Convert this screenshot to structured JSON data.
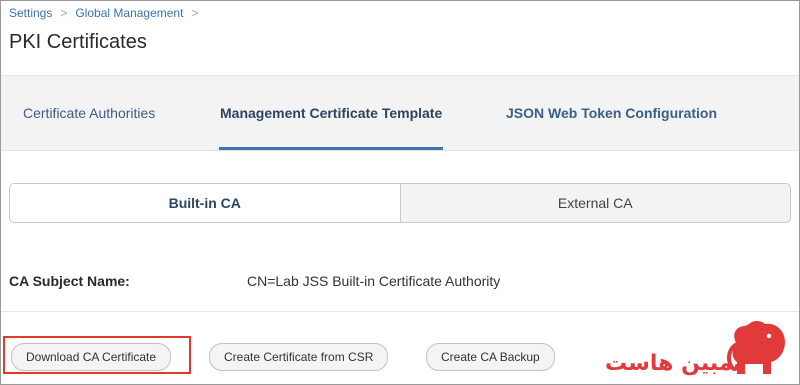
{
  "breadcrumb": {
    "items": [
      "Settings",
      "Global Management"
    ],
    "separator": ">"
  },
  "page": {
    "title": "PKI Certificates"
  },
  "tabs": [
    {
      "label": "Certificate Authorities",
      "active": false
    },
    {
      "label": "Management Certificate Template",
      "active": true
    },
    {
      "label": "JSON Web Token Configuration",
      "active": false
    }
  ],
  "ca_toggle": {
    "options": [
      "Built-in CA",
      "External CA"
    ],
    "selected": "Built-in CA"
  },
  "subject": {
    "label": "CA Subject Name:",
    "value": "CN=Lab JSS Built-in Certificate Authority"
  },
  "actions": {
    "download_label": "Download CA Certificate",
    "create_csr_label": "Create Certificate from CSR",
    "backup_label": "Create CA Backup"
  },
  "watermark": {
    "text": "مبین هاست",
    "icon": "elephant-logo"
  },
  "colors": {
    "link": "#3b74b0",
    "highlight": "#e23a2a",
    "watermark": "#e03a3a"
  }
}
